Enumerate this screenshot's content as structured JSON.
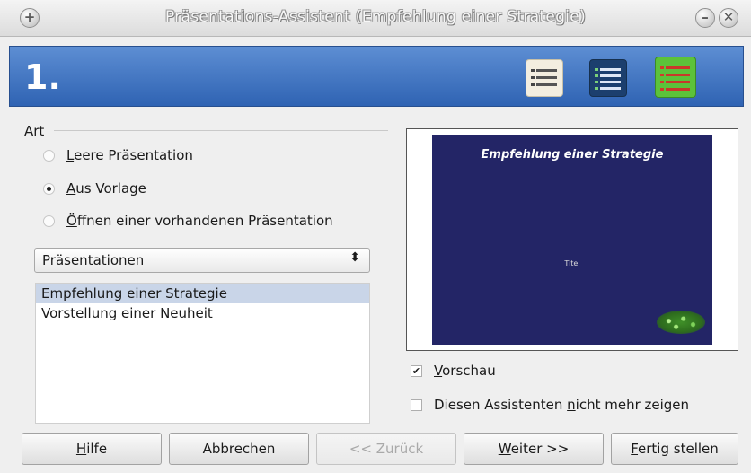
{
  "window": {
    "title": "Präsentations-Assistent (Empfehlung einer Strategie)",
    "left_button_glyph": "+",
    "minimize_glyph": "–",
    "close_glyph": "✕"
  },
  "banner": {
    "step": "1.",
    "icons": [
      "bulleted-list-icon",
      "blue-list-icon",
      "green-list-icon"
    ]
  },
  "type_group": {
    "label": "Art",
    "options": [
      {
        "first": "L",
        "rest": "eere Präsentation",
        "selected": false
      },
      {
        "first": "A",
        "rest": "us Vorlage",
        "selected": true
      },
      {
        "first": "Ö",
        "rest": "ffnen einer vorhandenen Präsentation",
        "selected": false
      }
    ]
  },
  "category_select": {
    "value": "Präsentationen",
    "arrow": "⬍"
  },
  "template_list": {
    "items": [
      "Empfehlung einer Strategie",
      "Vorstellung einer Neuheit"
    ],
    "selected_index": 0
  },
  "preview": {
    "slide_title": "Empfehlung einer Strategie",
    "slide_subtitle": "Titel",
    "background": "#232566"
  },
  "options": {
    "preview_first": "V",
    "preview_rest": "orschau",
    "preview_checked": true,
    "no_more_pre": "Diesen Assistenten ",
    "no_more_ul": "n",
    "no_more_post": "icht mehr zeigen",
    "no_more_checked": false
  },
  "buttons": {
    "help_ul": "H",
    "help_rest": "ilfe",
    "cancel": "Abbrechen",
    "back": "<< Zurück",
    "next_ul": "W",
    "next_rest": "eiter >>",
    "finish_ul": "F",
    "finish_rest": "ertig stellen"
  },
  "colors": {
    "banner": "#3f73c2",
    "selection": "#c9d5e8"
  }
}
